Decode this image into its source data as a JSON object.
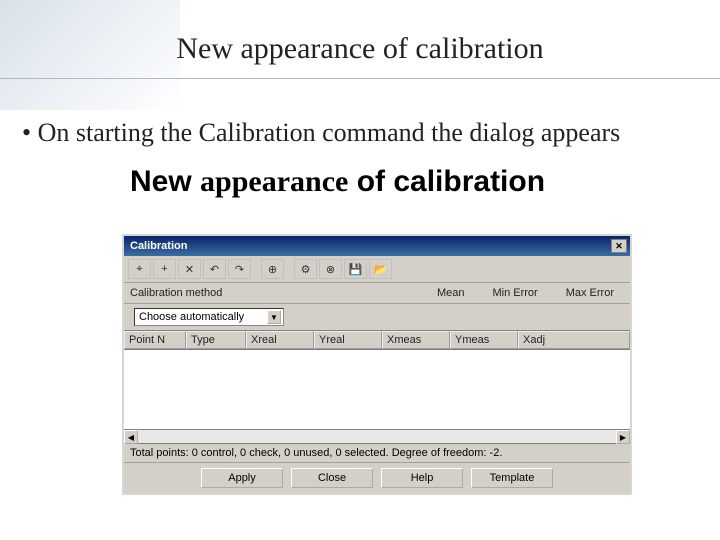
{
  "slide": {
    "title": "New appearance of calibration",
    "bullet": "• On starting the Calibration command the dialog appears",
    "sub_heading_pre": "New ",
    "sub_heading_mid": "appearance",
    "sub_heading_post": " of calibration"
  },
  "dialog": {
    "title": "Calibration",
    "close_glyph": "✕",
    "toolbar_icons": [
      "⌖",
      "+",
      "✕",
      "↶",
      "↷",
      "",
      "⊕",
      "",
      "⚙",
      "⊗",
      "💾",
      "📂"
    ],
    "method_label": "Calibration method",
    "method_value": "Choose automatically",
    "dropdown_arrow": "▼",
    "stats": {
      "mean": "Mean",
      "min": "Min Error",
      "max": "Max Error"
    },
    "columns": {
      "pointn": "Point N",
      "type": "Type",
      "xreal": "Xreal",
      "yreal": "Yreal",
      "xmeas": "Xmeas",
      "ymeas": "Ymeas",
      "xadj": "Xadj"
    },
    "scroll": {
      "left": "◀",
      "right": "▶"
    },
    "status": "Total points: 0 control, 0 check, 0 unused, 0 selected. Degree of freedom: -2.",
    "buttons": {
      "apply": "Apply",
      "close": "Close",
      "help": "Help",
      "template": "Template"
    }
  }
}
